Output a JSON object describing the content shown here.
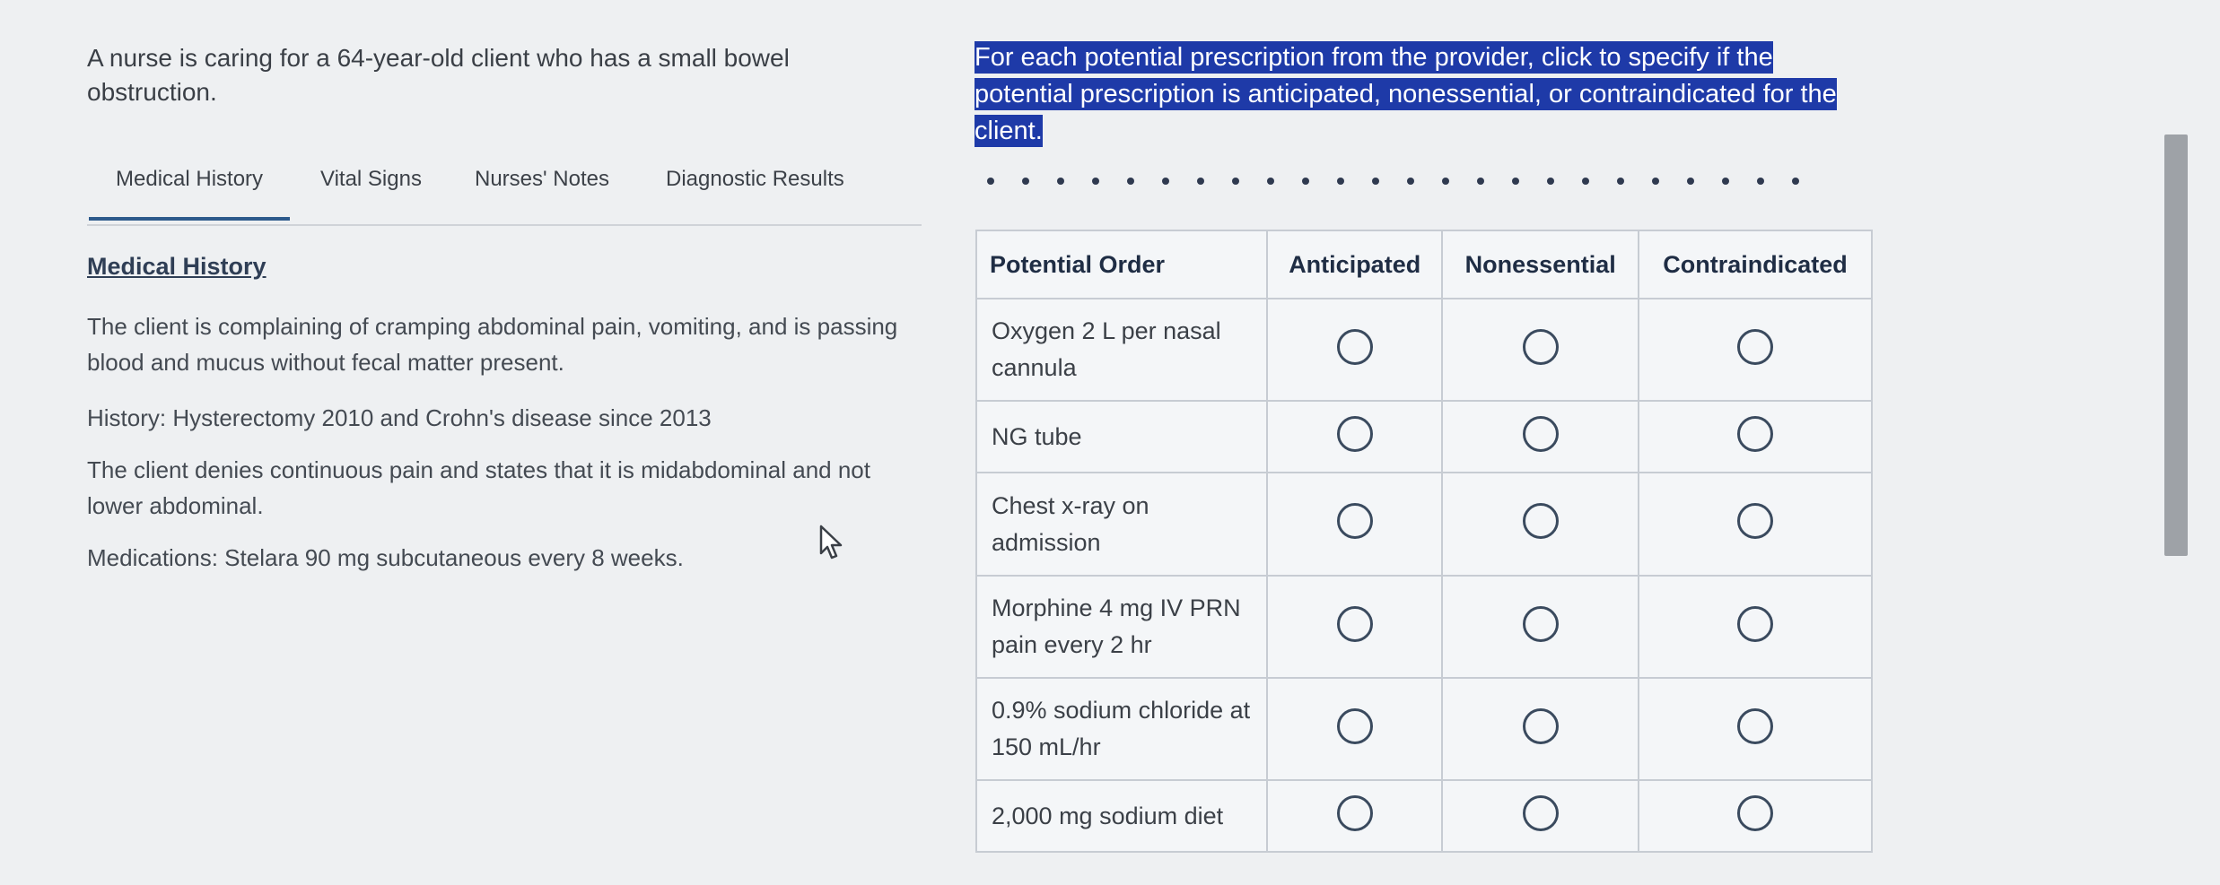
{
  "stem": "A nurse is caring for a 64-year-old client who has a small bowel obstruction.",
  "tabs": [
    {
      "label": "Medical History",
      "active": true
    },
    {
      "label": "Vital Signs",
      "active": false
    },
    {
      "label": "Nurses' Notes",
      "active": false
    },
    {
      "label": "Diagnostic Results",
      "active": false
    }
  ],
  "panel": {
    "title": "Medical History",
    "paragraphs": [
      "The client is complaining of cramping abdominal pain, vomiting, and is passing blood and mucus without fecal matter present.",
      "History: Hysterectomy 2010 and Crohn's disease since 2013",
      "The client denies continuous pain and states that it is midabdominal and not lower abdominal.",
      "Medications: Stelara 90 mg subcutaneous every 8 weeks."
    ]
  },
  "instruction": "For each potential prescription from the provider, click to specify if the potential prescription is anticipated, nonessential, or contraindicated for the client.",
  "grid": {
    "headers": [
      "Potential Order",
      "Anticipated",
      "Nonessential",
      "Contraindicated"
    ],
    "rows": [
      "Oxygen 2 L per nasal cannula",
      "NG tube",
      "Chest x-ray on admission",
      "Morphine 4 mg IV PRN pain every 2 hr",
      "0.9% sodium chloride at 150 mL/hr",
      "2,000 mg sodium diet"
    ]
  },
  "icons": {
    "cursor": "mouse-pointer-icon",
    "radio": "radio-button-icon"
  }
}
